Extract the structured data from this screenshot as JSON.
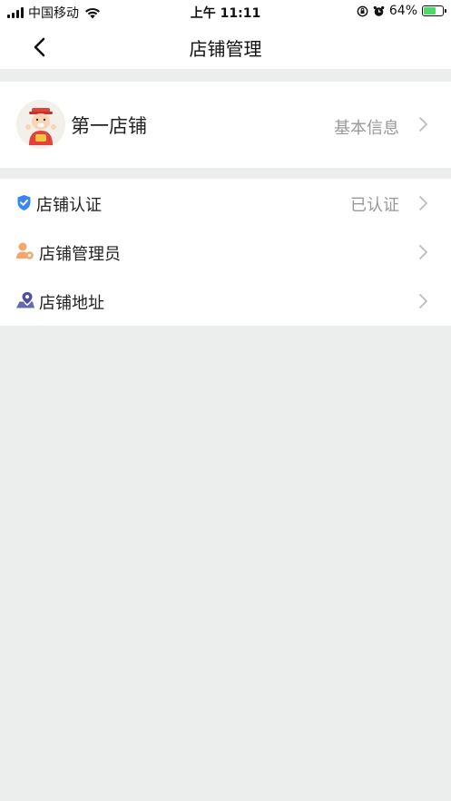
{
  "status_bar": {
    "carrier": "中国移动",
    "time": "上午 11:11",
    "battery_percent": "64%",
    "battery_level": 0.64
  },
  "nav": {
    "title": "店铺管理"
  },
  "store": {
    "name": "第一店铺",
    "info_label": "基本信息"
  },
  "menu": {
    "items": [
      {
        "label": "店铺认证",
        "value": "已认证",
        "icon": "shield-check-icon"
      },
      {
        "label": "店铺管理员",
        "value": "",
        "icon": "user-gear-icon"
      },
      {
        "label": "店铺地址",
        "value": "",
        "icon": "location-pin-icon"
      }
    ]
  },
  "colors": {
    "page_bg": "#eceeee",
    "shield_blue": "#3a86f7",
    "admin_orange": "#f4a66c",
    "address_indigo": "#4a4fa0",
    "secondary_text": "#999999"
  }
}
